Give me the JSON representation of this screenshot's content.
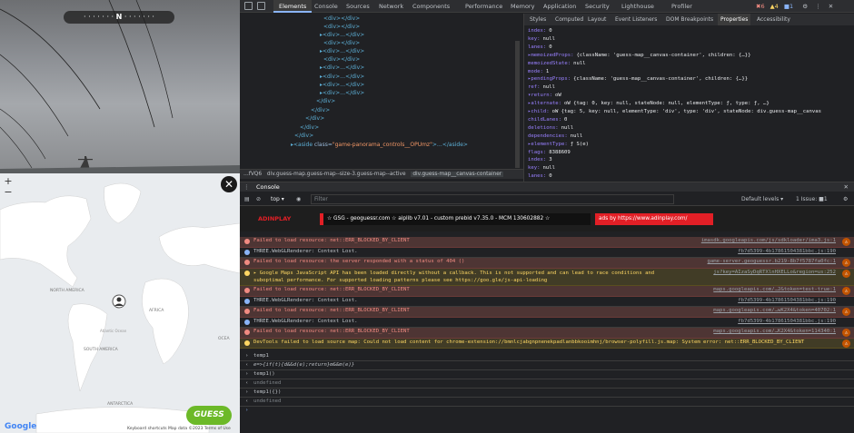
{
  "compass": {
    "n_label": "N"
  },
  "map": {
    "labels": [
      "NORTH AMERICA",
      "SOUTH AMERICA",
      "AFRICA",
      "ANTARCTICA",
      "Atlantic Ocean",
      "OCEA"
    ],
    "zoom_in": "+",
    "zoom_out": "−",
    "close": "✕",
    "guess_label": "GUESS",
    "google_label": "Google",
    "attribution": "Keyboard shortcuts   Map data ©2023   Terms of Use"
  },
  "devtools": {
    "tabs": [
      "Elements",
      "Console",
      "Sources",
      "Network",
      "Components",
      "Performance",
      "Memory",
      "Application",
      "Security",
      "Lighthouse",
      "Profiler"
    ],
    "active_tab": "Elements",
    "badges": {
      "errors": "6",
      "warnings": "4",
      "issues": "1"
    },
    "elements_lines": [
      "<div></div>",
      "<div></div>",
      "<div>…</div>",
      "<div></div>",
      "<div>…</div>",
      "<div></div>",
      "<div>…</div>",
      "<div>…</div>",
      "<div>…</div>",
      "<div>…</div>",
      "</div>",
      "</div>",
      "</div>",
      "</div>",
      "</div>"
    ],
    "aside_line": {
      "tag": "<aside",
      "attr": " class=",
      "val": "\"game-panorama_controls__OPUmz\"",
      "rest": ">…</aside>"
    },
    "breadcrumbs": [
      "…fVQ6",
      "div.guess-map.guess-map--size-3.guess-map--active",
      "div.guess-map__canvas-container"
    ],
    "side_tabs": [
      "Styles",
      "Computed",
      "Layout",
      "Event Listeners",
      "DOM Breakpoints",
      "Properties",
      "Accessibility"
    ],
    "active_side_tab": "Properties",
    "props": [
      {
        "k": "index:",
        "v": "0"
      },
      {
        "k": "key:",
        "v": "null"
      },
      {
        "k": "lanes:",
        "v": "0"
      },
      {
        "k": "▸memoizedProps:",
        "v": "{className: 'guess-map__canvas-container', children: {…}}"
      },
      {
        "k": "memoizedState:",
        "v": "null"
      },
      {
        "k": "mode:",
        "v": "1"
      },
      {
        "k": "▸pendingProps:",
        "v": "{className: 'guess-map__canvas-container', children: {…}}"
      },
      {
        "k": "ref:",
        "v": "null"
      },
      {
        "k": "▾return:",
        "v": "oW"
      },
      {
        "k": "  ▸alternate:",
        "v": "oW {tag: 0, key: null, stateNode: null, elementType: ƒ, type: ƒ, …}"
      },
      {
        "k": "  ▸child:",
        "v": "oW {tag: 5, key: null, elementType: 'div', type: 'div', stateNode: div.guess-map__canvas"
      },
      {
        "k": "  childLanes:",
        "v": "0"
      },
      {
        "k": "  deletions:",
        "v": "null"
      },
      {
        "k": "  dependencies:",
        "v": "null"
      },
      {
        "k": "  ▸elementType:",
        "v": "ƒ S(e)"
      },
      {
        "k": "  flags:",
        "v": "8388609"
      },
      {
        "k": "  index:",
        "v": "3"
      },
      {
        "k": "  key:",
        "v": "null"
      },
      {
        "k": "  lanes:",
        "v": "0"
      }
    ],
    "console_title": "Console",
    "top_context": "top",
    "filter_placeholder": "Filter",
    "default_levels": "Default levels ▾",
    "issue_count": "1 Issue: ■1",
    "ad": {
      "sauce": "ADINPLAY",
      "banner": "☆ GSG - geoguessr.com ☆ aiplib v7.01 - custom prebid v7.35.0 - MCM 130602882 ☆",
      "ads_by": "ads by https://www.adinplay.com/"
    },
    "console_rows": [
      {
        "type": "err",
        "msg": "Failed to load resource: net::ERR_BLOCKED_BY_CLIENT",
        "src": "imasdk.googleapis.com/js/sdkloader/ima3.js:1"
      },
      {
        "type": "info",
        "msg": "THREE.WebGLRenderer: Context Lost.",
        "src": "fb7d5399-4b17861504381bbc.js:190"
      },
      {
        "type": "err",
        "msg": "Failed to load resource: the server responded with a status of 404 ()",
        "src": "game-server.geoguessr.b219-8b7f5787fa0fc:1"
      },
      {
        "type": "warn",
        "msg": "▸ Google Maps JavaScript API has been loaded directly without a callback. This is not supported and can lead to race conditions and suboptimal performance. For supported loading patterns please see https://goo.gle/js-api-loading",
        "src": "js?key=AIzaSyDqRTXlnHXELLo&region=us:252"
      },
      {
        "type": "err",
        "msg": "Failed to load resource: net::ERR_BLOCKED_BY_CLIENT",
        "src": "maps.googleapis.com/…2&token=test-true:1"
      },
      {
        "type": "info",
        "msg": "THREE.WebGLRenderer: Context Lost.",
        "src": "fb7d5399-4b17861504381bbc.js:190"
      },
      {
        "type": "err",
        "msg": "Failed to load resource: net::ERR_BLOCKED_BY_CLIENT",
        "src": "maps.googleapis.com/…wK2X4&token=40702:1"
      },
      {
        "type": "info",
        "msg": "THREE.WebGLRenderer: Context Lost.",
        "src": "fb7d5399-4b17861504381bbc.js:190"
      },
      {
        "type": "err",
        "msg": "Failed to load resource: net::ERR_BLOCKED_BY_CLIENT",
        "src": "maps.googleapis.com/…K2X4&token=114340:1"
      },
      {
        "type": "warn",
        "msg": "DevTools failed to load source map: Could not load content for chrome-extension://bmnlcjabgnpnenekpadlanbbkooimhnj/browser-polyfill.js.map: System error: net::ERR_BLOCKED_BY_CLIENT",
        "src": ""
      }
    ],
    "repl": [
      {
        "t": "in",
        "text": "temp1"
      },
      {
        "t": "out",
        "text": "e=>{if(t){d&&d(e);return}m&&m(e)}"
      },
      {
        "t": "in",
        "text": "temp1()"
      },
      {
        "t": "undef",
        "text": "undefined"
      },
      {
        "t": "in",
        "text": "temp1({})"
      },
      {
        "t": "undef",
        "text": "undefined"
      }
    ],
    "prompt": "›"
  }
}
